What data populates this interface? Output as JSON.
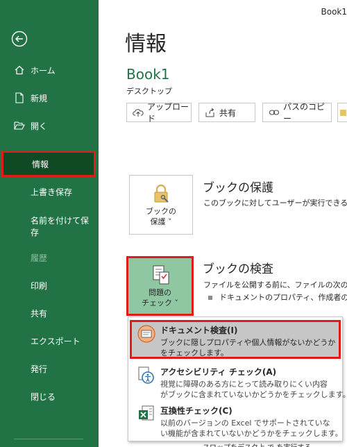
{
  "window": {
    "title": "Book1"
  },
  "sidebar": {
    "items": [
      {
        "label": "ホーム"
      },
      {
        "label": "新規"
      },
      {
        "label": "開く"
      },
      {
        "label": "情報"
      },
      {
        "label": "上書き保存"
      },
      {
        "label_line1": "名前を付けて保",
        "label_line2": "存"
      },
      {
        "label": "履歴"
      },
      {
        "label": "印刷"
      },
      {
        "label": "共有"
      },
      {
        "label": "エクスポート"
      },
      {
        "label": "発行"
      },
      {
        "label": "閉じる"
      }
    ],
    "colors": {
      "background": "#217346",
      "active": "#0f4a25",
      "highlight_border": "#e11a1a"
    }
  },
  "main": {
    "title": "情報",
    "book_name": "Book1",
    "book_path": "デスクトップ",
    "actions": [
      {
        "label": "アップロード",
        "icon": "upload-cloud-icon"
      },
      {
        "label": "共有",
        "icon": "share-icon"
      },
      {
        "label": "パスのコピー",
        "icon": "link-icon"
      }
    ],
    "protect": {
      "tile_line1": "ブックの",
      "tile_line2": "保護 ˅",
      "title": "ブックの保護",
      "desc": "このブックに対してユーザーが実行できる変更"
    },
    "inspect": {
      "tile_line1": "問題の",
      "tile_line2": "チェック ˅",
      "title": "ブックの検査",
      "desc": "ファイルを公開する前に、ファイルの次の項目",
      "bullet": "ドキュメントのプロパティ、作成者の名前"
    },
    "partial_row": "スワップをデスク上  で  を実行する"
  },
  "menu": {
    "items": [
      {
        "title": "ドキュメント検査(I)",
        "desc_line1": "ブックに隠しプロパティや個人情報がないかどうか",
        "desc_line2": "をチェックします。",
        "icon": "document-inspect-icon"
      },
      {
        "title": "アクセシビリティ チェック(A)",
        "desc_line1": "視覚に障碍のある方にとって読み取りにくい内容",
        "desc_line2": "がブックに含まれていないかどうかをチェックします。",
        "icon": "accessibility-icon"
      },
      {
        "title": "互換性チェック(C)",
        "desc_line1": "以前のバージョンの Excel でサポートされていな",
        "desc_line2": "い機能が含まれていないかどうかをチェックします。",
        "icon": "compatibility-icon"
      }
    ]
  }
}
